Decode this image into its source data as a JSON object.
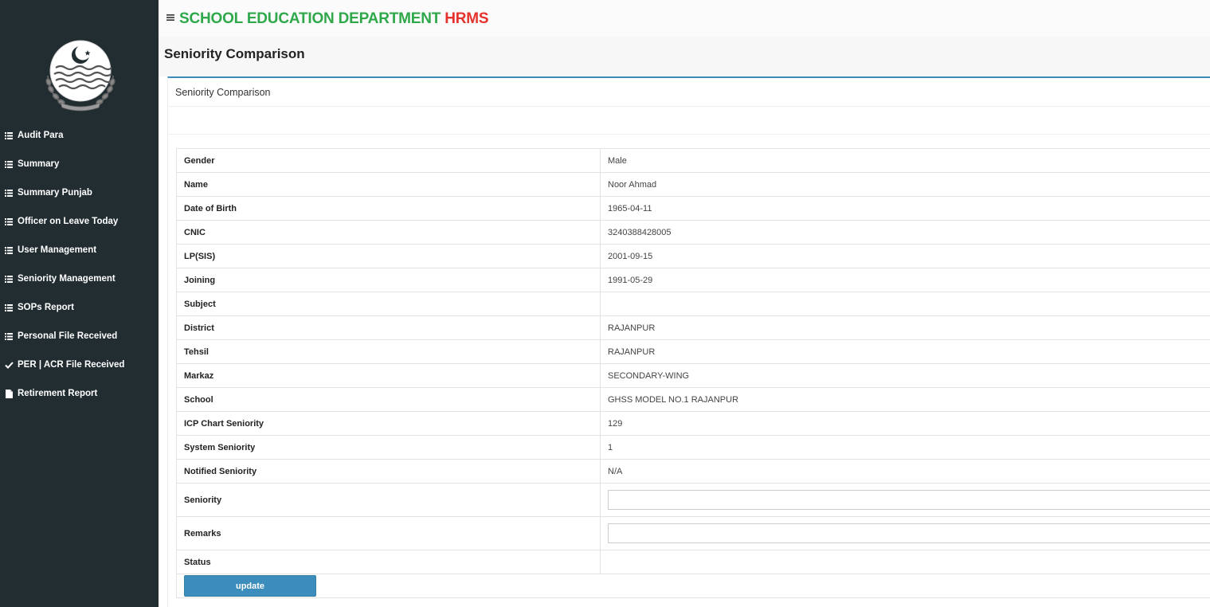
{
  "header": {
    "brand_main": "SCHOOL EDUCATION DEPARTMENT",
    "brand_accent": "HRMS",
    "brand_main_color": "#2ea84a",
    "brand_accent_color": "#e5322d"
  },
  "page": {
    "title": "Seniority Comparison",
    "box_title": "Seniority Comparison"
  },
  "sidebar": {
    "items": [
      {
        "label": "Audit Para",
        "icon": "list-icon"
      },
      {
        "label": "Summary",
        "icon": "list-icon"
      },
      {
        "label": "Summary Punjab",
        "icon": "list-icon"
      },
      {
        "label": "Officer on Leave Today",
        "icon": "list-icon"
      },
      {
        "label": "User Management",
        "icon": "list-icon"
      },
      {
        "label": "Seniority Management",
        "icon": "list-icon"
      },
      {
        "label": "SOPs Report",
        "icon": "list-icon"
      },
      {
        "label": "Personal File Received",
        "icon": "list-icon"
      },
      {
        "label": "PER | ACR File Received",
        "icon": "check-icon"
      },
      {
        "label": "Retirement Report",
        "icon": "file-icon"
      }
    ]
  },
  "details": {
    "rows": [
      {
        "label": "Gender",
        "value": "Male"
      },
      {
        "label": "Name",
        "value": "Noor Ahmad"
      },
      {
        "label": "Date of Birth",
        "value": "1965-04-11"
      },
      {
        "label": "CNIC",
        "value": "3240388428005"
      },
      {
        "label": "LP(SIS)",
        "value": "2001-09-15"
      },
      {
        "label": "Joining",
        "value": "1991-05-29"
      },
      {
        "label": "Subject",
        "value": ""
      },
      {
        "label": "District",
        "value": "RAJANPUR"
      },
      {
        "label": "Tehsil",
        "value": "RAJANPUR"
      },
      {
        "label": "Markaz",
        "value": "SECONDARY-WING"
      },
      {
        "label": "School",
        "value": "GHSS MODEL NO.1 RAJANPUR"
      },
      {
        "label": "ICP Chart Seniority",
        "value": "129"
      },
      {
        "label": "System Seniority",
        "value": "1"
      },
      {
        "label": "Notified Seniority",
        "value": "N/A"
      }
    ],
    "seniority_label": "Seniority",
    "seniority_value": "",
    "remarks_label": "Remarks",
    "remarks_value": "",
    "status_label": "Status",
    "status_value": ""
  },
  "actions": {
    "update_label": "update"
  },
  "colors": {
    "sidebar_bg": "#222d32",
    "accent": "#3c8dbc"
  }
}
